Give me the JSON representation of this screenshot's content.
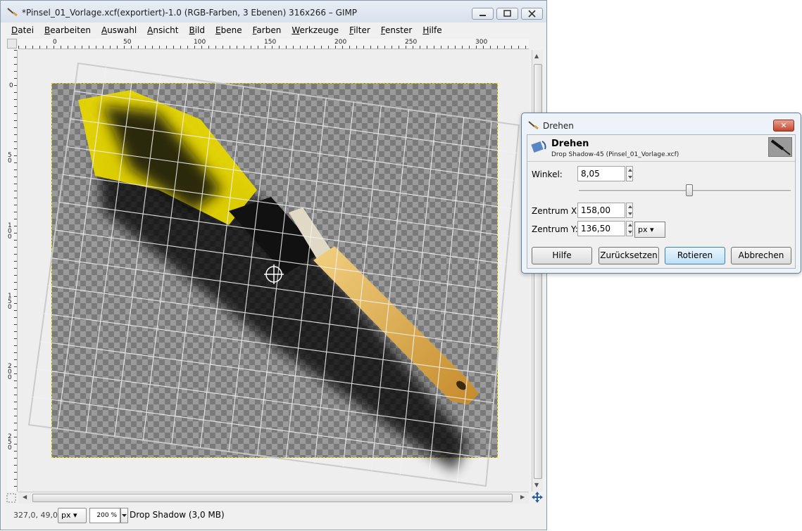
{
  "window": {
    "title": "*Pinsel_01_Vorlage.xcf(exportiert)-1.0 (RGB-Farben, 3 Ebenen) 316x266 – GIMP"
  },
  "menu": [
    "Datei",
    "Bearbeiten",
    "Auswahl",
    "Ansicht",
    "Bild",
    "Ebene",
    "Farben",
    "Werkzeuge",
    "Filter",
    "Fenster",
    "Hilfe"
  ],
  "ruler": {
    "top": [
      "0",
      "50",
      "100",
      "150",
      "200",
      "250",
      "300"
    ],
    "left": [
      "0",
      "50",
      "100",
      "150",
      "200",
      "250"
    ]
  },
  "status": {
    "coords": "327,0, 49,0",
    "unit": "px",
    "zoom": "200 %",
    "layer_info": "Drop Shadow (3,0 MB)"
  },
  "dialog": {
    "window_title": "Drehen",
    "header_title": "Drehen",
    "header_subtitle": "Drop Shadow-45 (Pinsel_01_Vorlage.xcf)",
    "angle_label": "Winkel:",
    "angle_value": "8,05",
    "angle_slider_fraction": 0.52,
    "center_x_label": "Zentrum X:",
    "center_x_value": "158,00",
    "center_y_label": "Zentrum Y:",
    "center_y_value": "136,50",
    "unit": "px",
    "buttons": {
      "help": "Hilfe",
      "reset": "Zurücksetzen",
      "rotate": "Rotieren",
      "cancel": "Abbrechen"
    }
  },
  "icons": [
    "gimp-icon",
    "rotate-tool-icon",
    "layer-preview-icon"
  ]
}
